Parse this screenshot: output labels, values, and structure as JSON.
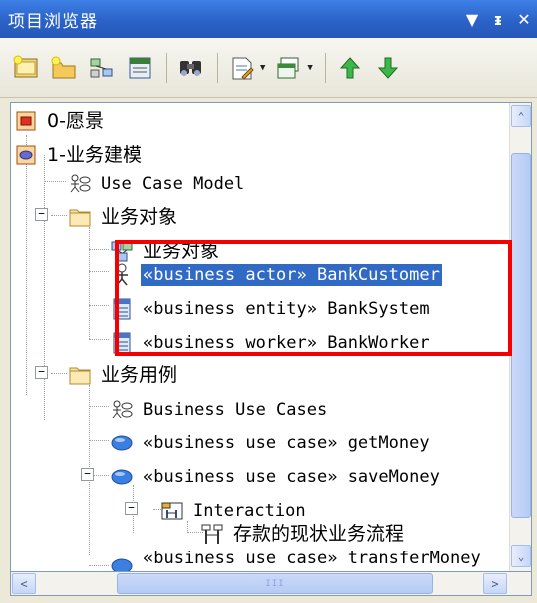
{
  "window": {
    "title": "项目浏览器",
    "buttons": [
      "▼",
      "ᵻ",
      "✕"
    ]
  },
  "toolbar": {
    "icons": [
      "new-package-icon",
      "new-folder-icon",
      "new-diagram-icon",
      "new-element-icon",
      "find-icon",
      "document-icon",
      "view-options-icon",
      "move-up-icon",
      "move-down-icon"
    ]
  },
  "tree": {
    "items": [
      {
        "label": "0-愿景",
        "icon": "view-red-icon"
      },
      {
        "label": "1-业务建模",
        "icon": "view-blue-icon"
      },
      {
        "label": "Use Case Model",
        "icon": "use-case-diagram-icon"
      },
      {
        "label": "业务对象",
        "icon": "folder-icon"
      },
      {
        "label": "业务对象",
        "icon": "class-diagram-icon"
      },
      {
        "label": "«business actor» BankCustomer",
        "icon": "actor-icon"
      },
      {
        "label": "«business entity» BankSystem",
        "icon": "entity-icon"
      },
      {
        "label": "«business worker» BankWorker",
        "icon": "worker-icon"
      },
      {
        "label": "业务用例",
        "icon": "folder-icon"
      },
      {
        "label": "Business Use Cases",
        "icon": "use-case-diagram-icon"
      },
      {
        "label": "«business use case» getMoney",
        "icon": "use-case-icon"
      },
      {
        "label": "«business use case» saveMoney",
        "icon": "use-case-icon"
      },
      {
        "label": "Interaction",
        "icon": "interaction-icon"
      },
      {
        "label": "存款的现状业务流程",
        "icon": "sequence-diagram-icon"
      },
      {
        "label": "«business use case» transferMoney",
        "icon": "use-case-icon"
      }
    ]
  },
  "scroll": {
    "up": "⌃",
    "down": "⌄",
    "left": "<",
    "right": ">",
    "grip": "III"
  },
  "colors": {
    "selection": "#316ac5",
    "highlight_box": "#f50000",
    "titlebar": "#2b63c8"
  }
}
